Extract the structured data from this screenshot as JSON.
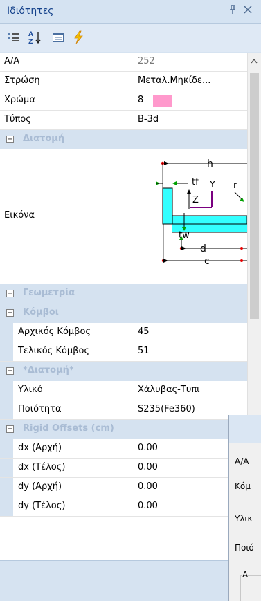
{
  "window": {
    "title": "Ιδιότητες",
    "pin_glyph": "ᵖ",
    "close_glyph": "✕"
  },
  "toolbar": {
    "buttons": [
      {
        "name": "categorized-icon"
      },
      {
        "name": "sort-az-icon",
        "text": "A Z"
      },
      {
        "name": "property-pages-icon"
      },
      {
        "name": "events-icon"
      }
    ]
  },
  "properties": {
    "aa": {
      "label": "Α/Α",
      "value": "252"
    },
    "layer": {
      "label": "Στρώση",
      "value": "Μεταλ.Μηκίδε..."
    },
    "color": {
      "label": "Χρώμα",
      "value": "8",
      "swatch": "#ff99cc"
    },
    "type": {
      "label": "Τύπος",
      "value": "B-3d"
    }
  },
  "categories": {
    "section": {
      "toggle": "+",
      "title": "Διατομή"
    },
    "geometry": {
      "toggle": "+",
      "title": "Γεωμετρία"
    },
    "nodes": {
      "toggle": "−",
      "title": "Κόμβοι"
    },
    "section2": {
      "toggle": "−",
      "title": "*Διατομή*"
    },
    "rigid": {
      "toggle": "−",
      "title": "Rigid Offsets (cm)"
    }
  },
  "image_row": {
    "label": "Εικόνα",
    "labels": {
      "h": "h",
      "tf": "tf",
      "y": "Y",
      "r": "r",
      "z": "Z",
      "tw": "tw",
      "d": "d",
      "c": "c"
    },
    "colors": {
      "section_fill": "#33ffff",
      "dim_red": "#e60000",
      "arrow_green": "#00a000",
      "axis": "#7a0080"
    }
  },
  "nodes": {
    "start": {
      "label": "Αρχικός Κόμβος",
      "value": "45"
    },
    "end": {
      "label": "Τελικός Κόμβος",
      "value": "51"
    }
  },
  "section2": {
    "material": {
      "label": "Υλικό",
      "value": "Χάλυβας-Τυπι"
    },
    "quality": {
      "label": "Ποιότητα",
      "value": "S235(Fe360)"
    }
  },
  "rigid": {
    "dx_start": {
      "label": "dx (Αρχή)",
      "value": "0.00"
    },
    "dx_end": {
      "label": "dx (Τέλος)",
      "value": "0.00"
    },
    "dy_start": {
      "label": "dy (Αρχή)",
      "value": "0.00"
    },
    "dy_end": {
      "label": "dy (Τέλος)",
      "value": "0.00"
    }
  },
  "overlay_dialog": {
    "label_aa": "Α/Α",
    "label_kom": "Κόμ",
    "label_yli": "Υλικ",
    "label_poi": "Ποιό",
    "label_a": "Α"
  }
}
